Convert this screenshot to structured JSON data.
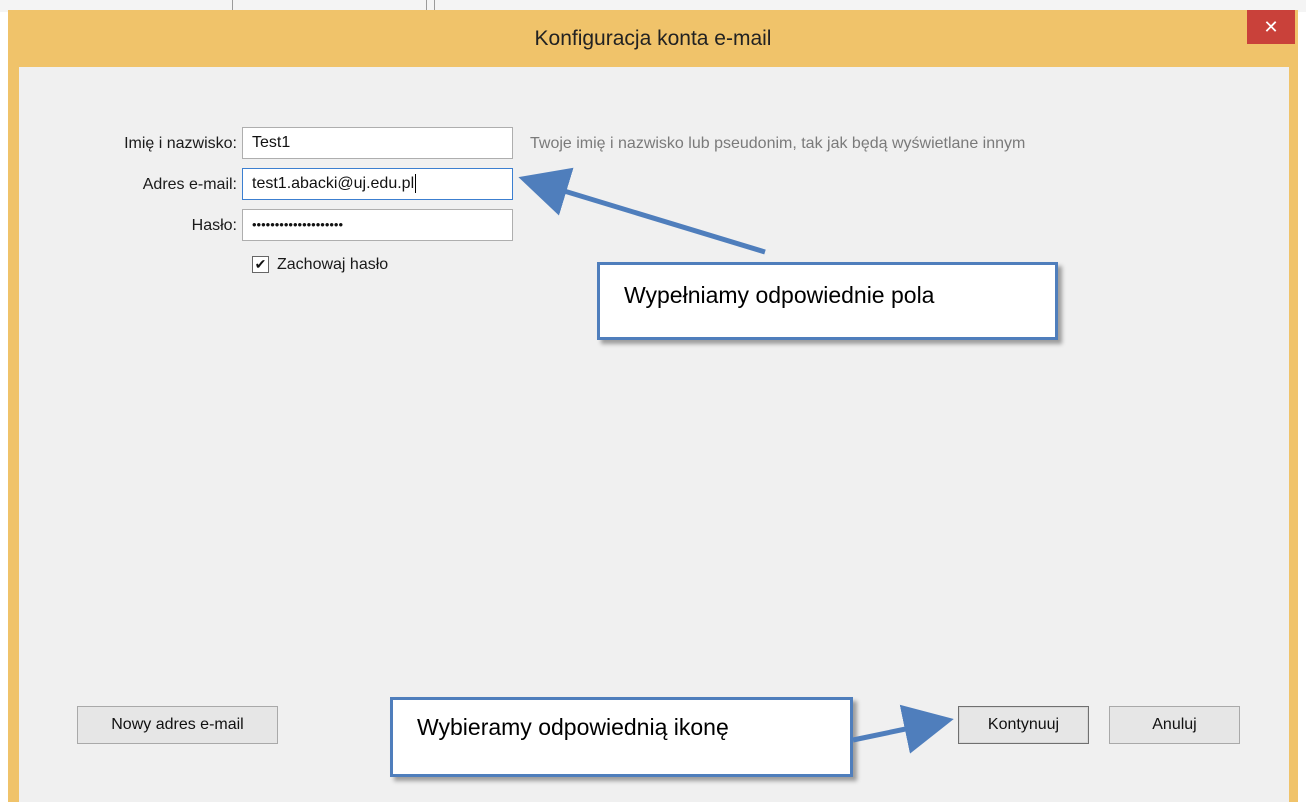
{
  "window": {
    "title": "Konfiguracja konta e-mail",
    "close_glyph": "✕"
  },
  "form": {
    "name_label": "Imię i nazwisko:",
    "name_value": "Test1",
    "name_hint": "Twoje imię i nazwisko lub pseudonim, tak jak będą wyświetlane innym",
    "email_label": "Adres e-mail:",
    "email_value": "test1.abacki@uj.edu.pl",
    "password_label": "Hasło:",
    "password_value": "••••••••••••••••••••",
    "remember_label": "Zachowaj hasło",
    "remember_checked": true,
    "check_glyph": "✔"
  },
  "buttons": {
    "new_address": "Nowy adres e-mail",
    "continue": "Kontynuuj",
    "cancel": "Anuluj"
  },
  "annotations": {
    "callout_fields": "Wypełniamy odpowiednie pola",
    "callout_button": "Wybieramy odpowiednią ikonę",
    "accent": "#4f7ebc"
  },
  "colors": {
    "titlebar": "#f0c36a",
    "close": "#c9413a",
    "client": "#f0f0f0"
  }
}
